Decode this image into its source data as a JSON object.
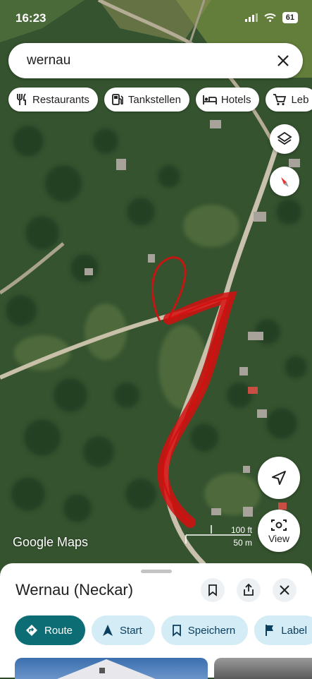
{
  "status": {
    "time": "16:23",
    "battery": "61"
  },
  "search": {
    "query": "wernau"
  },
  "chips": [
    {
      "label": "Restaurants",
      "icon": "fork-knife-icon"
    },
    {
      "label": "Tankstellen",
      "icon": "gas-pump-icon"
    },
    {
      "label": "Hotels",
      "icon": "bed-icon"
    },
    {
      "label": "Leb",
      "icon": "cart-icon"
    }
  ],
  "map": {
    "watermark": "Google Maps",
    "scale_ft": "100 ft",
    "scale_m": "50 m",
    "view_label": "View"
  },
  "place": {
    "title": "Wernau (Neckar)",
    "actions": [
      {
        "label": "Route",
        "icon": "directions-icon"
      },
      {
        "label": "Start",
        "icon": "navigation-arrow-icon"
      },
      {
        "label": "Speichern",
        "icon": "bookmark-icon"
      },
      {
        "label": "Label",
        "icon": "flag-icon"
      }
    ]
  },
  "colors": {
    "accent": "#0d6d74",
    "action_bg": "#d3ecf5",
    "annotation": "#d40f0f"
  }
}
